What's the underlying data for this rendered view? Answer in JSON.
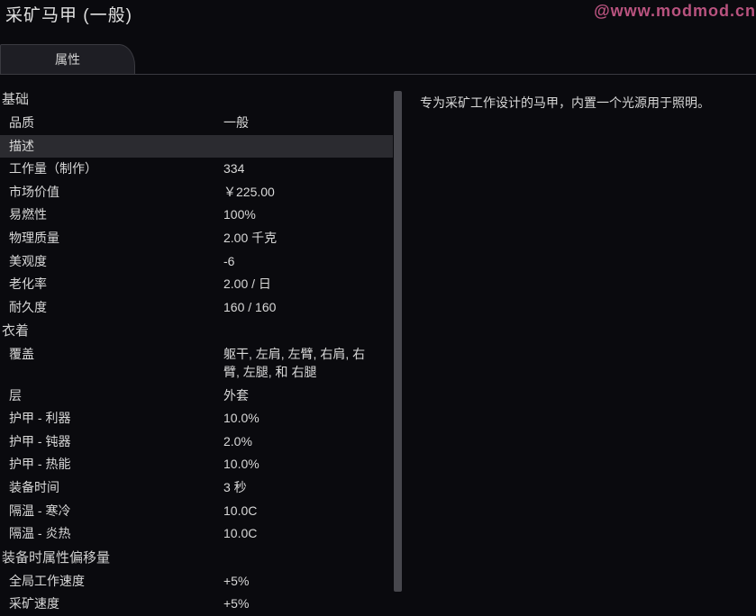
{
  "title": "采矿马甲 (一般)",
  "watermark": "@www.modmod.cn",
  "tab_label": "属性",
  "description": "专为采矿工作设计的马甲，内置一个光源用于照明。",
  "sections": {
    "basic": {
      "header": "基础",
      "rows": {
        "quality": {
          "label": "品质",
          "value": "一般"
        },
        "desc": {
          "label": "描述",
          "value": ""
        },
        "work": {
          "label": "工作量（制作）",
          "value": "334"
        },
        "market": {
          "label": "市场价值",
          "value": "￥225.00"
        },
        "flammability": {
          "label": "易燃性",
          "value": "100%"
        },
        "mass": {
          "label": "物理质量",
          "value": "2.00 千克"
        },
        "beauty": {
          "label": "美观度",
          "value": "-6"
        },
        "deterioration": {
          "label": "老化率",
          "value": "2.00 / 日"
        },
        "durability": {
          "label": "耐久度",
          "value": "160 / 160"
        }
      }
    },
    "apparel": {
      "header": "衣着",
      "rows": {
        "covers": {
          "label": "覆盖",
          "value": "躯干, 左肩, 左臂, 右肩, 右臂, 左腿, 和 右腿"
        },
        "layer": {
          "label": "层",
          "value": "外套"
        },
        "armor_sharp": {
          "label": "护甲 - 利器",
          "value": "10.0%"
        },
        "armor_blunt": {
          "label": "护甲 - 钝器",
          "value": "2.0%"
        },
        "armor_heat": {
          "label": "护甲 - 热能",
          "value": "10.0%"
        },
        "equip_delay": {
          "label": "装备时间",
          "value": "3 秒"
        },
        "insul_cold": {
          "label": "隔温 - 寒冷",
          "value": "10.0C"
        },
        "insul_heat": {
          "label": "隔温 - 炎热",
          "value": "10.0C"
        }
      }
    },
    "offsets": {
      "header": "装备时属性偏移量",
      "rows": {
        "global_work": {
          "label": "全局工作速度",
          "value": "+5%"
        },
        "mining": {
          "label": "采矿速度",
          "value": "+5%"
        }
      }
    }
  }
}
